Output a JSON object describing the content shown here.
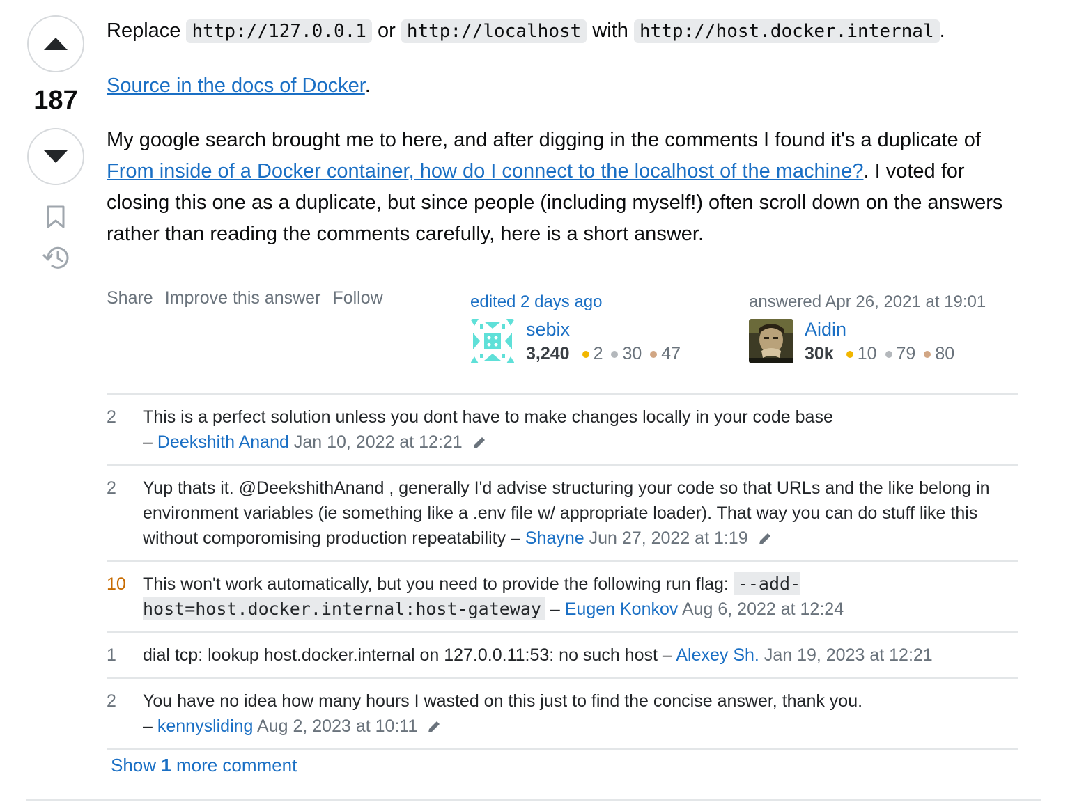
{
  "vote": {
    "count": "187"
  },
  "answer": {
    "p1_a": "Replace ",
    "code1": "http://127.0.0.1",
    "p1_b": " or ",
    "code2": "http://localhost",
    "p1_c": " with ",
    "code3": "http://host.docker.internal",
    "p1_d": ".",
    "source_link": "Source in the docs of Docker",
    "source_after": ".",
    "p3_a": "My google search brought me to here, and after digging in the comments I found it's a duplicate of ",
    "dup_link": "From inside of a Docker container, how do I connect to the localhost of the machine?",
    "p3_b": ". I voted for closing this one as a duplicate, but since people (including myself!) often scroll down on the answers rather than reading the comments carefully, here is a short answer."
  },
  "menu": {
    "share": "Share",
    "improve": "Improve this answer",
    "follow": "Follow"
  },
  "editor": {
    "action": "edited 2 days ago",
    "name": "sebix",
    "rep": "3,240",
    "gold": "2",
    "silver": "30",
    "bronze": "47"
  },
  "author": {
    "action": "answered Apr 26, 2021 at 19:01",
    "name": "Aidin",
    "rep": "30k",
    "gold": "10",
    "silver": "79",
    "bronze": "80"
  },
  "comments": [
    {
      "score": "2",
      "text": "This is a perfect solution unless you dont have to make changes locally in your code base",
      "sep": "– ",
      "user": "Deekshith Anand",
      "date": "Jan 10, 2022 at 12:21"
    },
    {
      "score": "2",
      "text": "Yup thats it. @DeekshithAnand , generally I'd advise structuring your code so that URLs and the like belong in environment variables (ie something like a .env file w/ appropriate loader). That way you can do stuff like this without comporomising production repeatability",
      "sep": " – ",
      "user": "Shayne",
      "date": "Jun 27, 2022 at 1:19"
    },
    {
      "score": "10",
      "text": "This won't work automatically, but you need to provide the following run flag: ",
      "code": "--add-host=host.docker.internal:host-gateway",
      "sep": " – ",
      "user": "Eugen Konkov",
      "date": "Aug 6, 2022 at 12:24"
    },
    {
      "score": "1",
      "text": "dial tcp: lookup host.docker.internal on 127.0.0.11:53: no such host",
      "sep": " – ",
      "user": "Alexey Sh.",
      "date": "Jan 19, 2023 at 12:21"
    },
    {
      "score": "2",
      "text": "You have no idea how many hours I wasted on this just to find the concise answer, thank you.",
      "sep": "– ",
      "user": "kennysliding",
      "date": "Aug 2, 2023 at 10:11"
    }
  ],
  "show_more": {
    "prefix": "Show ",
    "count": "1",
    "suffix": " more comment"
  },
  "icons": {
    "upvote": "upvote-arrow-icon",
    "downvote": "downvote-arrow-icon",
    "bookmark": "bookmark-icon",
    "history": "history-icon",
    "edit": "pencil-icon"
  },
  "colors": {
    "link": "#1a6fc4",
    "muted": "#6a737c",
    "hot_score": "#c76b00",
    "gold": "#f1b600",
    "silver": "#b4b8bc",
    "bronze": "#d1a684"
  }
}
